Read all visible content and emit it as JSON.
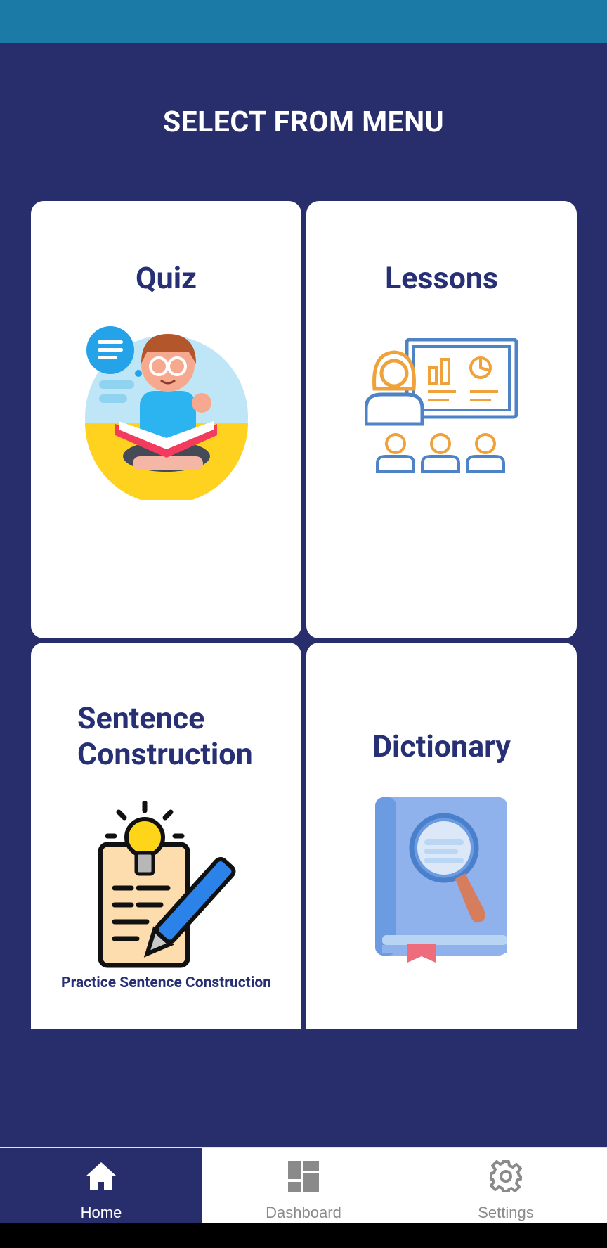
{
  "header": {
    "title": "SELECT FROM MENU"
  },
  "menu": {
    "quiz": {
      "label": "Quiz"
    },
    "lessons": {
      "label": "Lessons"
    },
    "sentence": {
      "label_line1": "Sentence",
      "label_line2": "Construction",
      "subtitle": "Practice Sentence Construction"
    },
    "dictionary": {
      "label": "Dictionary"
    }
  },
  "bottom_nav": {
    "items": [
      {
        "label": "Home",
        "icon": "home-icon",
        "active": true
      },
      {
        "label": "Dashboard",
        "icon": "dashboard-icon",
        "active": false
      },
      {
        "label": "Settings",
        "icon": "gear-icon",
        "active": false
      }
    ]
  },
  "colors": {
    "background": "#272e6b",
    "status_bar": "#1c7aa6",
    "label": "#273074",
    "inactive": "#8a8a8a"
  }
}
